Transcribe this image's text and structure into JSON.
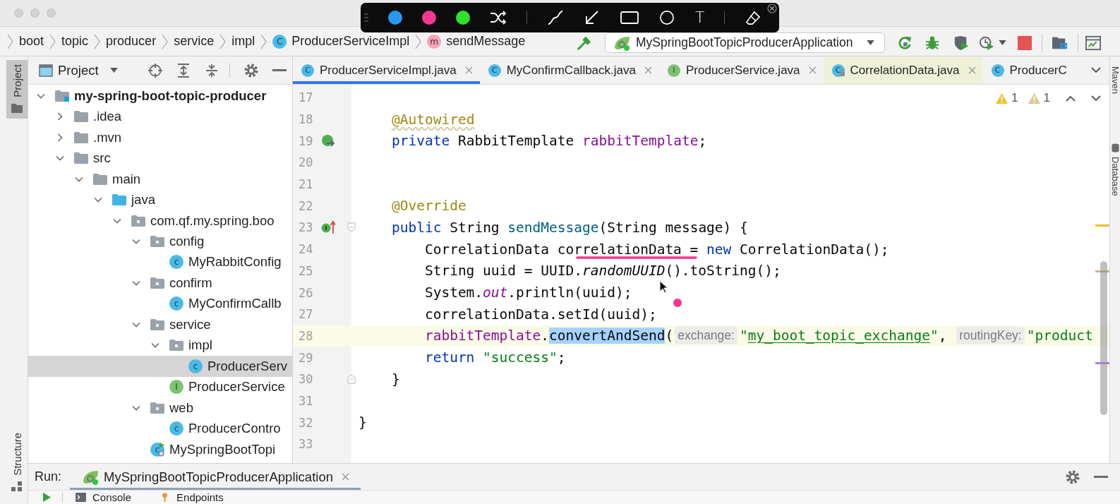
{
  "annotation_toolbar": {
    "pen_colors": [
      {
        "color": "#2a98f0"
      },
      {
        "color": "#f2388f"
      },
      {
        "color": "#2fe02c"
      }
    ],
    "text_tool": "T"
  },
  "breadcrumbs": [
    {
      "label": "boot",
      "kind": "plain"
    },
    {
      "label": "topic",
      "kind": "plain"
    },
    {
      "label": "producer",
      "kind": "plain"
    },
    {
      "label": "service",
      "kind": "plain"
    },
    {
      "label": "impl",
      "kind": "plain"
    },
    {
      "label": "ProducerServiceImpl",
      "kind": "class",
      "icon_text": "C"
    },
    {
      "label": "sendMessage",
      "kind": "method",
      "icon_text": "m"
    }
  ],
  "run_configuration": {
    "label": "MySpringBootTopicProducerApplication"
  },
  "left_stripe": [
    {
      "label": "Project",
      "selected": true
    },
    {
      "label": "Structure",
      "selected": false
    }
  ],
  "project_panel": {
    "title": "Project",
    "tree": [
      {
        "label": "my-spring-boot-topic-producer",
        "kind": "module",
        "expanded": true,
        "selected": false,
        "children": [
          {
            "label": ".idea",
            "kind": "folder",
            "expanded": false,
            "selected": false
          },
          {
            "label": ".mvn",
            "kind": "folder",
            "expanded": false,
            "selected": false
          },
          {
            "label": "src",
            "kind": "folder",
            "expanded": true,
            "selected": false,
            "children": [
              {
                "label": "main",
                "kind": "folder",
                "expanded": true,
                "selected": false,
                "children": [
                  {
                    "label": "java",
                    "kind": "source_folder",
                    "expanded": true,
                    "selected": false,
                    "children": [
                      {
                        "label": "com.qf.my.spring.boo",
                        "kind": "package",
                        "expanded": true,
                        "selected": false,
                        "children": [
                          {
                            "label": "config",
                            "kind": "package",
                            "expanded": true,
                            "selected": false,
                            "children": [
                              {
                                "label": "MyRabbitConfig",
                                "kind": "class",
                                "icon_text": "c",
                                "selected": false
                              }
                            ]
                          },
                          {
                            "label": "confirm",
                            "kind": "package",
                            "expanded": true,
                            "selected": false,
                            "children": [
                              {
                                "label": "MyConfirmCallb",
                                "kind": "class",
                                "icon_text": "c",
                                "selected": false
                              }
                            ]
                          },
                          {
                            "label": "service",
                            "kind": "package",
                            "expanded": true,
                            "selected": false,
                            "children": [
                              {
                                "label": "impl",
                                "kind": "package",
                                "expanded": true,
                                "selected": false,
                                "children": [
                                  {
                                    "label": "ProducerServ",
                                    "kind": "class",
                                    "icon_text": "c",
                                    "selected": true
                                  }
                                ]
                              },
                              {
                                "label": "ProducerService",
                                "kind": "interface",
                                "icon_text": "I",
                                "selected": false
                              }
                            ]
                          },
                          {
                            "label": "web",
                            "kind": "package",
                            "expanded": true,
                            "selected": false,
                            "children": [
                              {
                                "label": "ProducerContro",
                                "kind": "class",
                                "icon_text": "c",
                                "selected": false
                              }
                            ]
                          },
                          {
                            "label": "MySpringBootTopi",
                            "kind": "spring_app",
                            "icon_text": "c",
                            "selected": false
                          }
                        ]
                      }
                    ]
                  }
                ]
              }
            ]
          }
        ]
      }
    ]
  },
  "editor_tabs": [
    {
      "label": "ProducerServiceImpl.java",
      "kind": "class",
      "icon_text": "C",
      "selected": true,
      "read_only": false,
      "closable": true
    },
    {
      "label": "MyConfirmCallback.java",
      "kind": "class",
      "icon_text": "C",
      "selected": false,
      "read_only": false,
      "closable": true
    },
    {
      "label": "ProducerService.java",
      "kind": "interface",
      "icon_text": "I",
      "selected": false,
      "read_only": false,
      "closable": true
    },
    {
      "label": "CorrelationData.java",
      "kind": "class_locked",
      "icon_text": "C",
      "selected": false,
      "read_only": true,
      "closable": true
    },
    {
      "label": "ProducerC",
      "kind": "class",
      "icon_text": "C",
      "selected": false,
      "read_only": false,
      "closable": false
    }
  ],
  "editor": {
    "problems": [
      {
        "kind": "warning",
        "count": "1"
      },
      {
        "kind": "weak_warning",
        "count": "1"
      }
    ],
    "lines": [
      {
        "number": "17",
        "current": false
      },
      {
        "number": "18",
        "current": false,
        "tokens": [
          {
            "text": "    @Autowired",
            "kind": "annotation_warning"
          }
        ]
      },
      {
        "number": "19",
        "current": false,
        "gutter_marks": [
          {
            "kind": "bean"
          }
        ],
        "tokens": [
          {
            "text": "    private",
            "kind": "keyword"
          },
          {
            "text": " RabbitTemplate ",
            "kind": "plain"
          },
          {
            "text": "rabbitTemplate",
            "kind": "field"
          },
          {
            "text": ";",
            "kind": "plain"
          }
        ]
      },
      {
        "number": "20",
        "current": false
      },
      {
        "number": "21",
        "current": false
      },
      {
        "number": "22",
        "current": false,
        "tokens": [
          {
            "text": "    @Override",
            "kind": "annotation"
          }
        ]
      },
      {
        "number": "23",
        "current": false,
        "gutter_marks": [
          {
            "kind": "implements"
          },
          {
            "kind": "fold_start"
          }
        ],
        "tokens": [
          {
            "text": "    public",
            "kind": "keyword"
          },
          {
            "text": " String ",
            "kind": "plain"
          },
          {
            "text": "sendMessage",
            "kind": "method"
          },
          {
            "text": "(String message) {",
            "kind": "plain"
          }
        ]
      },
      {
        "number": "24",
        "current": false,
        "tokens": [
          {
            "text": "        CorrelationData correlationData = ",
            "kind": "plain"
          },
          {
            "text": "new",
            "kind": "keyword"
          },
          {
            "text": " CorrelationData();",
            "kind": "plain"
          }
        ]
      },
      {
        "number": "25",
        "current": false,
        "tokens": [
          {
            "text": "        String uuid = UUID.",
            "kind": "plain"
          },
          {
            "text": "randomUUID",
            "kind": "static_method"
          },
          {
            "text": "().toString();",
            "kind": "plain"
          }
        ]
      },
      {
        "number": "26",
        "current": false,
        "tokens": [
          {
            "text": "        System.",
            "kind": "plain"
          },
          {
            "text": "out",
            "kind": "static_field"
          },
          {
            "text": ".println(uuid);",
            "kind": "plain"
          }
        ]
      },
      {
        "number": "27",
        "current": false,
        "tokens": [
          {
            "text": "        correlationData.setId(uuid);",
            "kind": "plain"
          }
        ]
      },
      {
        "number": "28",
        "current": true,
        "tokens": [
          {
            "text": "        rabbitTemplate",
            "kind": "field"
          },
          {
            "text": ".",
            "kind": "plain"
          },
          {
            "text": "convertAndSend",
            "kind": "selected"
          },
          {
            "text": "(",
            "kind": "plain"
          },
          {
            "text": "exchange:",
            "kind": "hint"
          },
          {
            "text": "\"",
            "kind": "string"
          },
          {
            "text": "my_boot_topic_exchange",
            "kind": "string_link"
          },
          {
            "text": "\"",
            "kind": "string"
          },
          {
            "text": ", ",
            "kind": "plain"
          },
          {
            "text": "routingKey:",
            "kind": "hint"
          },
          {
            "text": "\"product",
            "kind": "string"
          }
        ]
      },
      {
        "number": "29",
        "current": false,
        "tokens": [
          {
            "text": "        return ",
            "kind": "keyword"
          },
          {
            "text": "\"success\"",
            "kind": "string"
          },
          {
            "text": ";",
            "kind": "plain"
          }
        ]
      },
      {
        "number": "30",
        "current": false,
        "gutter_marks": [
          {
            "kind": "fold_end"
          }
        ],
        "tokens": [
          {
            "text": "    }",
            "kind": "plain"
          }
        ]
      },
      {
        "number": "31",
        "current": false
      },
      {
        "number": "32",
        "current": false,
        "tokens": [
          {
            "text": "}",
            "kind": "plain"
          }
        ]
      },
      {
        "number": "33",
        "current": false
      }
    ]
  },
  "right_stripe": [
    {
      "label": "Maven",
      "kind": "plain"
    },
    {
      "label": "Database",
      "kind": "database"
    }
  ],
  "run_panel": {
    "title": "Run:",
    "tab": {
      "label": "MySpringBootTopicProducerApplication",
      "selected": true
    },
    "tabs": [
      {
        "label": "Console",
        "kind": "console"
      },
      {
        "label": "Endpoints",
        "kind": "endpoints"
      }
    ]
  }
}
